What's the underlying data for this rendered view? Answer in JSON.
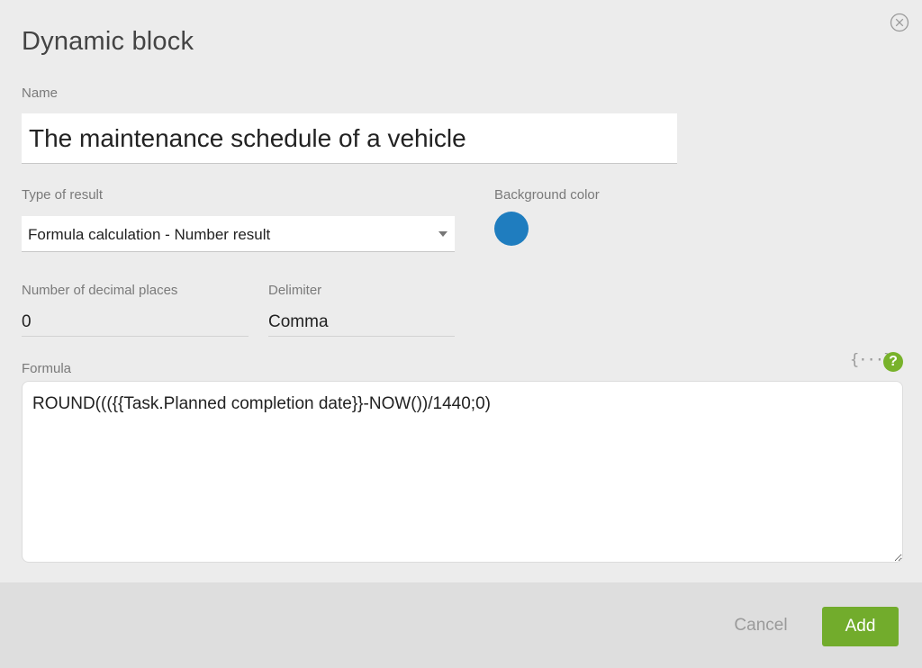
{
  "dialog": {
    "title": "Dynamic block"
  },
  "name": {
    "label": "Name",
    "value": "The maintenance schedule of a vehicle"
  },
  "result_type": {
    "label": "Type of result",
    "value": "Formula calculation - Number result"
  },
  "background_color": {
    "label": "Background color",
    "value": "#1f7dbf"
  },
  "decimal_places": {
    "label": "Number of decimal places",
    "value": "0"
  },
  "delimiter": {
    "label": "Delimiter",
    "value": "Comma"
  },
  "formula": {
    "label": "Formula",
    "value": "ROUND((({{Task.Planned completion date}}-NOW())/1440;0)",
    "braces_icon": "{···}",
    "help_icon": "?"
  },
  "footer": {
    "cancel_label": "Cancel",
    "add_label": "Add"
  },
  "colors": {
    "accent_green": "#72ac2c",
    "swatch_blue": "#1f7dbf"
  }
}
